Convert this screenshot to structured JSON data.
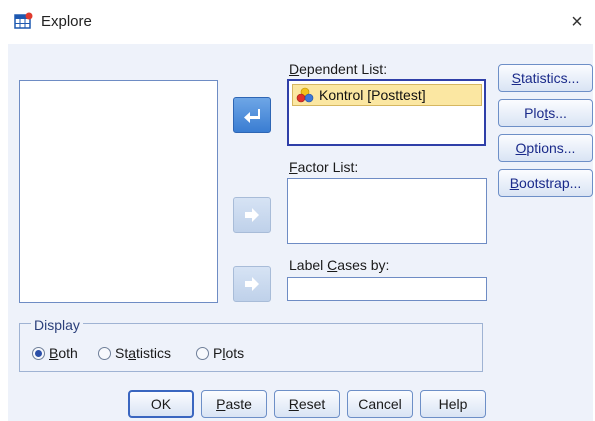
{
  "window": {
    "title": "Explore",
    "close_glyph": "×"
  },
  "icons": {
    "app": "spss-table-icon",
    "variable": "scale-variable-icon",
    "arrow_left": "arrow-left-icon",
    "arrow_right": "arrow-right-icon"
  },
  "dependent_list": {
    "label": "Dependent List:",
    "items": [
      "Kontrol [Posttest]"
    ]
  },
  "factor_list": {
    "label": "Factor List:"
  },
  "label_cases": {
    "label": "Label Cases by:"
  },
  "side_buttons": {
    "statistics": "Statistics...",
    "plots": "Plots...",
    "options": "Options...",
    "bootstrap": "Bootstrap..."
  },
  "display": {
    "legend": "Display",
    "both": "Both",
    "statistics": "Statistics",
    "plots": "Plots",
    "selected": "Both"
  },
  "bottom_buttons": {
    "ok": "OK",
    "paste": "Paste",
    "reset": "Reset",
    "cancel": "Cancel",
    "help": "Help"
  },
  "colors": {
    "selected_item": "#fbe7a2",
    "focus_border": "#2f3fa8",
    "active_arrow": "#3a7dd2"
  }
}
